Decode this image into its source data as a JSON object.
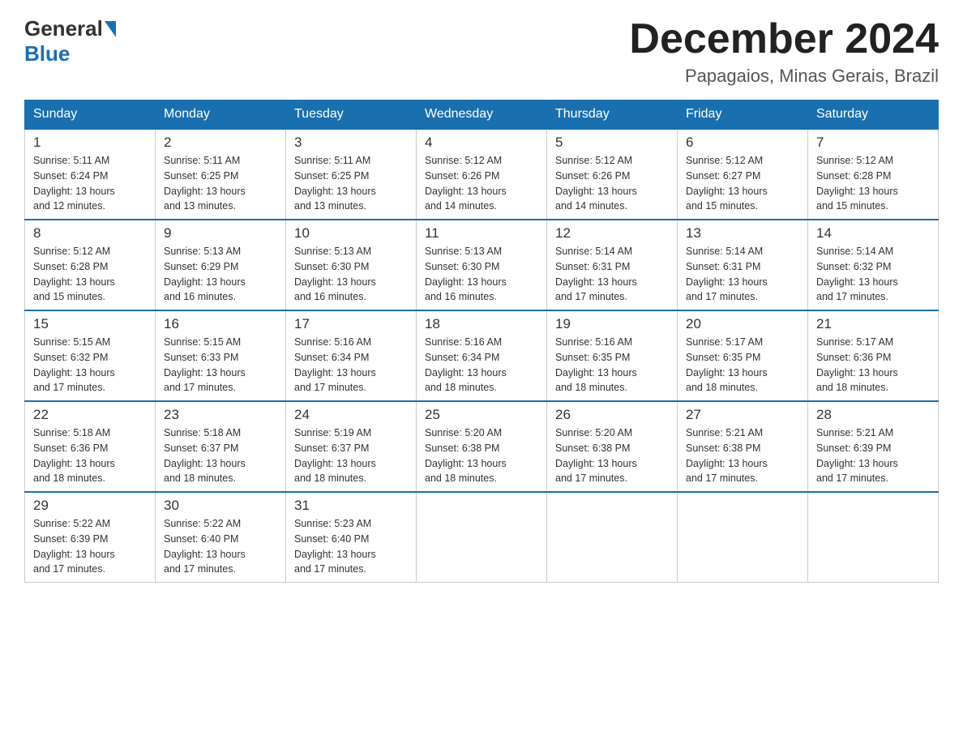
{
  "logo": {
    "general": "General",
    "blue": "Blue"
  },
  "title": "December 2024",
  "subtitle": "Papagaios, Minas Gerais, Brazil",
  "days_of_week": [
    "Sunday",
    "Monday",
    "Tuesday",
    "Wednesday",
    "Thursday",
    "Friday",
    "Saturday"
  ],
  "weeks": [
    [
      {
        "day": 1,
        "sunrise": "5:11 AM",
        "sunset": "6:24 PM",
        "daylight": "13 hours and 12 minutes."
      },
      {
        "day": 2,
        "sunrise": "5:11 AM",
        "sunset": "6:25 PM",
        "daylight": "13 hours and 13 minutes."
      },
      {
        "day": 3,
        "sunrise": "5:11 AM",
        "sunset": "6:25 PM",
        "daylight": "13 hours and 13 minutes."
      },
      {
        "day": 4,
        "sunrise": "5:12 AM",
        "sunset": "6:26 PM",
        "daylight": "13 hours and 14 minutes."
      },
      {
        "day": 5,
        "sunrise": "5:12 AM",
        "sunset": "6:26 PM",
        "daylight": "13 hours and 14 minutes."
      },
      {
        "day": 6,
        "sunrise": "5:12 AM",
        "sunset": "6:27 PM",
        "daylight": "13 hours and 15 minutes."
      },
      {
        "day": 7,
        "sunrise": "5:12 AM",
        "sunset": "6:28 PM",
        "daylight": "13 hours and 15 minutes."
      }
    ],
    [
      {
        "day": 8,
        "sunrise": "5:12 AM",
        "sunset": "6:28 PM",
        "daylight": "13 hours and 15 minutes."
      },
      {
        "day": 9,
        "sunrise": "5:13 AM",
        "sunset": "6:29 PM",
        "daylight": "13 hours and 16 minutes."
      },
      {
        "day": 10,
        "sunrise": "5:13 AM",
        "sunset": "6:30 PM",
        "daylight": "13 hours and 16 minutes."
      },
      {
        "day": 11,
        "sunrise": "5:13 AM",
        "sunset": "6:30 PM",
        "daylight": "13 hours and 16 minutes."
      },
      {
        "day": 12,
        "sunrise": "5:14 AM",
        "sunset": "6:31 PM",
        "daylight": "13 hours and 17 minutes."
      },
      {
        "day": 13,
        "sunrise": "5:14 AM",
        "sunset": "6:31 PM",
        "daylight": "13 hours and 17 minutes."
      },
      {
        "day": 14,
        "sunrise": "5:14 AM",
        "sunset": "6:32 PM",
        "daylight": "13 hours and 17 minutes."
      }
    ],
    [
      {
        "day": 15,
        "sunrise": "5:15 AM",
        "sunset": "6:32 PM",
        "daylight": "13 hours and 17 minutes."
      },
      {
        "day": 16,
        "sunrise": "5:15 AM",
        "sunset": "6:33 PM",
        "daylight": "13 hours and 17 minutes."
      },
      {
        "day": 17,
        "sunrise": "5:16 AM",
        "sunset": "6:34 PM",
        "daylight": "13 hours and 17 minutes."
      },
      {
        "day": 18,
        "sunrise": "5:16 AM",
        "sunset": "6:34 PM",
        "daylight": "13 hours and 18 minutes."
      },
      {
        "day": 19,
        "sunrise": "5:16 AM",
        "sunset": "6:35 PM",
        "daylight": "13 hours and 18 minutes."
      },
      {
        "day": 20,
        "sunrise": "5:17 AM",
        "sunset": "6:35 PM",
        "daylight": "13 hours and 18 minutes."
      },
      {
        "day": 21,
        "sunrise": "5:17 AM",
        "sunset": "6:36 PM",
        "daylight": "13 hours and 18 minutes."
      }
    ],
    [
      {
        "day": 22,
        "sunrise": "5:18 AM",
        "sunset": "6:36 PM",
        "daylight": "13 hours and 18 minutes."
      },
      {
        "day": 23,
        "sunrise": "5:18 AM",
        "sunset": "6:37 PM",
        "daylight": "13 hours and 18 minutes."
      },
      {
        "day": 24,
        "sunrise": "5:19 AM",
        "sunset": "6:37 PM",
        "daylight": "13 hours and 18 minutes."
      },
      {
        "day": 25,
        "sunrise": "5:20 AM",
        "sunset": "6:38 PM",
        "daylight": "13 hours and 18 minutes."
      },
      {
        "day": 26,
        "sunrise": "5:20 AM",
        "sunset": "6:38 PM",
        "daylight": "13 hours and 17 minutes."
      },
      {
        "day": 27,
        "sunrise": "5:21 AM",
        "sunset": "6:38 PM",
        "daylight": "13 hours and 17 minutes."
      },
      {
        "day": 28,
        "sunrise": "5:21 AM",
        "sunset": "6:39 PM",
        "daylight": "13 hours and 17 minutes."
      }
    ],
    [
      {
        "day": 29,
        "sunrise": "5:22 AM",
        "sunset": "6:39 PM",
        "daylight": "13 hours and 17 minutes."
      },
      {
        "day": 30,
        "sunrise": "5:22 AM",
        "sunset": "6:40 PM",
        "daylight": "13 hours and 17 minutes."
      },
      {
        "day": 31,
        "sunrise": "5:23 AM",
        "sunset": "6:40 PM",
        "daylight": "13 hours and 17 minutes."
      },
      null,
      null,
      null,
      null
    ]
  ]
}
